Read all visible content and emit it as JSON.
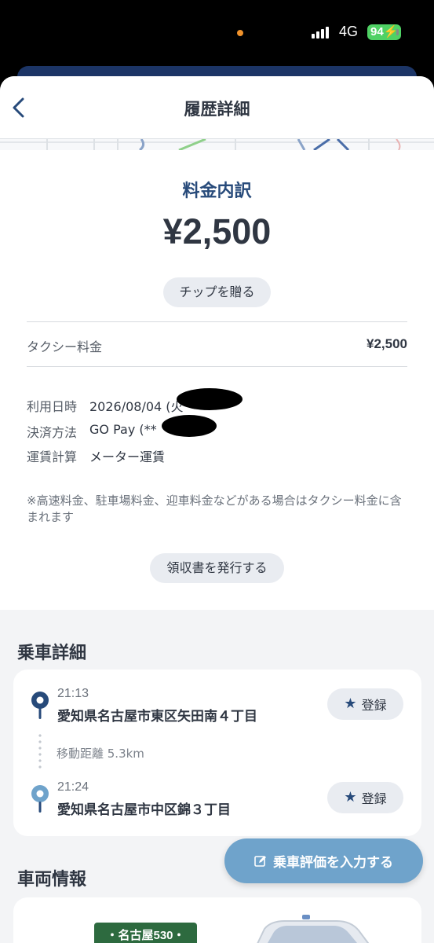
{
  "status": {
    "network": "4G",
    "battery": "94"
  },
  "header": {
    "title": "履歴詳細"
  },
  "fare": {
    "title": "料金内訳",
    "total": "¥2,500",
    "tip_button": "チップを贈る",
    "line_label": "タクシー料金",
    "line_value": "¥2,500"
  },
  "info": {
    "rows": [
      {
        "label": "利用日時",
        "value": "2026/08/04 (火"
      },
      {
        "label": "決済方法",
        "value": "GO Pay (**"
      },
      {
        "label": "運賃計算",
        "value": "メーター運賃"
      }
    ]
  },
  "note": "※高速料金、駐車場料金、迎車料金などがある場合はタクシー料金に含まれます",
  "receipt_button": "領収書を発行する",
  "ride": {
    "section_title": "乗車詳細",
    "pickup": {
      "time": "21:13",
      "address": "愛知県名古屋市東区矢田南４丁目"
    },
    "distance": "移動距離 5.3km",
    "dropoff": {
      "time": "21:24",
      "address": "愛知県名古屋市中区錦３丁目"
    },
    "register_label": "登録"
  },
  "rate_button": "乗車評価を入力する",
  "vehicle": {
    "section_title": "車両情報",
    "plate": "・名古屋530・"
  },
  "colors": {
    "accent_navy": "#274a7a",
    "rate_button": "#6fa3cb",
    "plate_green": "#2d6a3f"
  }
}
